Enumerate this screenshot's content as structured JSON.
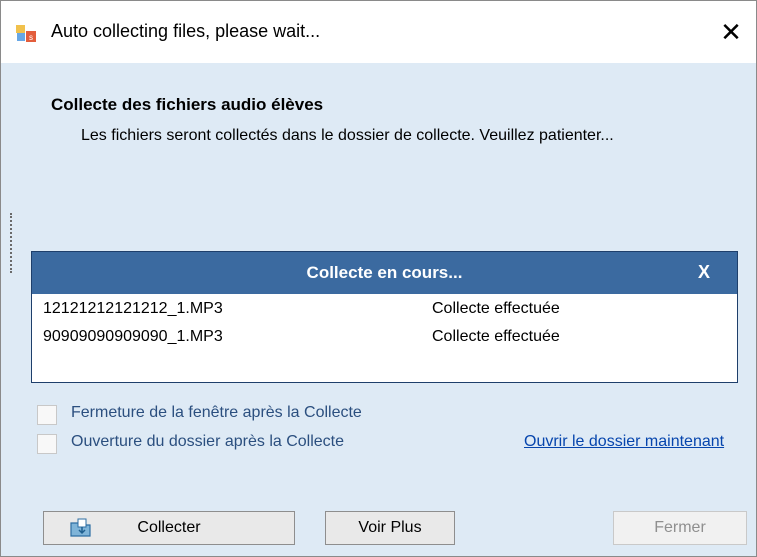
{
  "window": {
    "title": "Auto collecting files, please wait...",
    "heading": "Collecte des fichiers audio élèves",
    "subheading": "Les fichiers seront collectés dans le dossier de collecte. Veuillez patienter..."
  },
  "panel": {
    "title": "Collecte en cours...",
    "close_label": "X",
    "rows": [
      {
        "file": "12121212121212_1.MP3",
        "status": "Collecte effectuée"
      },
      {
        "file": "90909090909090_1.MP3",
        "status": "Collecte effectuée"
      }
    ]
  },
  "options": {
    "close_after": "Fermeture de la fenêtre après la Collecte",
    "open_after": "Ouverture du dossier après la Collecte",
    "open_now_link": "Ouvrir le dossier maintenant"
  },
  "buttons": {
    "collect": "Collecter",
    "more": "Voir Plus",
    "close": "Fermer"
  },
  "colors": {
    "panel_header": "#3b6aa0",
    "body_bg": "#deeaf5",
    "link": "#0645ad"
  },
  "icons": {
    "app": "app-icon",
    "close": "close-icon",
    "collect": "folder-icon"
  }
}
